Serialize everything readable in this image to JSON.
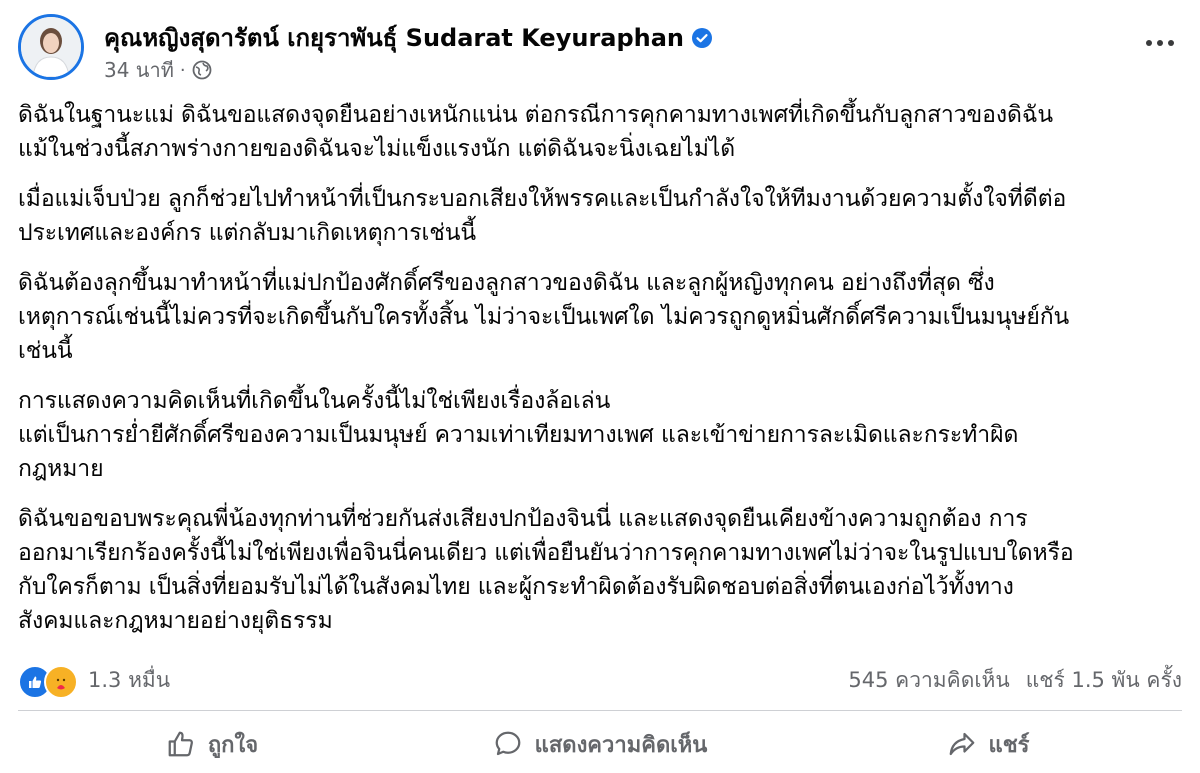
{
  "post": {
    "author": "คุณหญิงสุดารัตน์ เกยุราพันธุ์ Sudarat Keyuraphan",
    "time": "34 นาที",
    "separator": "·",
    "verified_icon": "verified-badge-icon",
    "privacy_icon": "globe-icon",
    "paragraphs": [
      "ดิฉันในฐานะแม่ ดิฉันขอแสดงจุดยืนอย่างเหนักแน่น ต่อกรณีการคุกคามทางเพศที่เกิดขึ้นกับลูกสาวของดิฉัน\nแม้ในช่วงนี้สภาพร่างกายของดิฉันจะไม่แข็งแรงนัก แต่ดิฉันจะนิ่งเฉยไม่ได้",
      "เมื่อแม่เจ็บป่วย ลูกก็ช่วยไปทำหน้าที่เป็นกระบอกเสียงให้พรรคและเป็นกำลังใจให้ทีมงานด้วยความตั้งใจที่ดีต่อ\nประเทศและองค์กร แต่กลับมาเกิดเหตุการเช่นนี้",
      "ดิฉันต้องลุกขึ้นมาทำหน้าที่แม่ปกป้องศักดิ์ศรีของลูกสาวของดิฉัน และลูกผู้หญิงทุกคน อย่างถึงที่สุด ซึ่ง\nเหตุการณ์เช่นนี้ไม่ควรที่จะเกิดขึ้นกับใครทั้งสิ้น ไม่ว่าจะเป็นเพศใด ไม่ควรถูกดูหมิ่นศักดิ์ศรีความเป็นมนุษย์กัน\nเช่นนี้",
      "การแสดงความคิดเห็นที่เกิดขึ้นในครั้งนี้ไม่ใช่เพียงเรื่องล้อเล่น\nแต่เป็นการย่ำยีศักดิ์ศรีของความเป็นมนุษย์ ความเท่าเทียมทางเพศ และเข้าข่ายการละเมิดและกระทำผิด\nกฎหมาย",
      "ดิฉันขอขอบพระคุณพี่น้องทุกท่านที่ช่วยกันส่งเสียงปกป้องจินนี่ และแสดงจุดยืนเคียงข้างความถูกต้อง การ\nออกมาเรียกร้องครั้งนี้ไม่ใช่เพียงเพื่อจินนี่คนเดียว แต่เพื่อยืนยันว่าการคุกคามทางเพศไม่ว่าจะในรูปแบบใดหรือ\nกับใครก็ตาม เป็นสิ่งที่ยอมรับไม่ได้ในสังคมไทย และผู้กระทำผิดต้องรับผิดชอบต่อสิ่งที่ตนเองก่อไว้ทั้งทาง\nสังคมและกฎหมายอย่างยุติธรรม"
    ]
  },
  "stats": {
    "reactions_count": "1.3 หมื่น",
    "comments": "545 ความคิดเห็น",
    "shares": "แชร์ 1.5 พัน ครั้ง",
    "reaction_icons": [
      "like-reaction-icon",
      "care-reaction-icon"
    ]
  },
  "actions": {
    "like": "ถูกใจ",
    "comment": "แสดงความคิดเห็น",
    "share": "แชร์"
  },
  "colors": {
    "accent": "#1b74e4",
    "secondary_text": "#65676b",
    "divider": "#ced0d4"
  }
}
